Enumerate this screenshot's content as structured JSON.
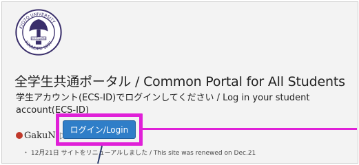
{
  "panel": {
    "title": "全学生共通ポータル / Common Portal for All Students",
    "instruction": "学生アカウント(ECS-ID)でログインしてください / Log in your student account(ECS-ID)",
    "gakunin_label": "GakuNi",
    "login_label": "ログイン/Login",
    "notice": "・ 12月21日 サイトをリニューアルしました / This site was renewed on Dec.21"
  },
  "seal": {
    "ring_text": "KYOTO UNIVERSITY · FOUNDED 1897",
    "center_text": "KYOTO JAPAN"
  },
  "colors": {
    "highlight": "#e020d8",
    "button": "#2f7ec8",
    "seal": "#3a2f6b"
  }
}
